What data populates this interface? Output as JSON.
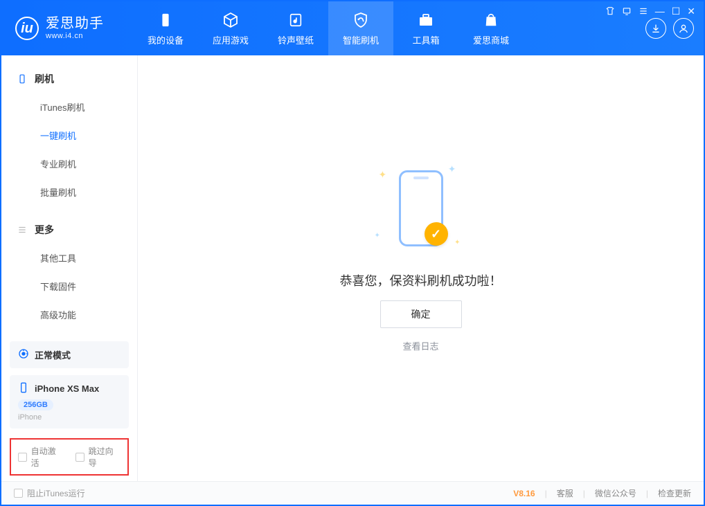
{
  "app": {
    "name": "爱思助手",
    "url": "www.i4.cn"
  },
  "window_ctrls": {
    "shirt": "◇",
    "lock": "☐",
    "menu": "≡",
    "min": "—",
    "max": "☐",
    "close": "✕"
  },
  "tabs": [
    {
      "id": "device",
      "label": "我的设备"
    },
    {
      "id": "apps",
      "label": "应用游戏"
    },
    {
      "id": "media",
      "label": "铃声壁纸"
    },
    {
      "id": "flash",
      "label": "智能刷机",
      "active": true
    },
    {
      "id": "toolbox",
      "label": "工具箱"
    },
    {
      "id": "store",
      "label": "爱思商城"
    }
  ],
  "sidebar": {
    "groups": [
      {
        "title": "刷机",
        "icon": "flash-icon",
        "items": [
          {
            "id": "itunes",
            "label": "iTunes刷机"
          },
          {
            "id": "onekey",
            "label": "一键刷机",
            "active": true
          },
          {
            "id": "pro",
            "label": "专业刷机"
          },
          {
            "id": "batch",
            "label": "批量刷机"
          }
        ]
      },
      {
        "title": "更多",
        "icon": "more-icon",
        "items": [
          {
            "id": "other",
            "label": "其他工具"
          },
          {
            "id": "fw",
            "label": "下载固件"
          },
          {
            "id": "adv",
            "label": "高级功能"
          }
        ]
      }
    ]
  },
  "mode_card": {
    "label": "正常模式"
  },
  "device_card": {
    "name": "iPhone XS Max",
    "capacity": "256GB",
    "type": "iPhone"
  },
  "bottom_opts": {
    "auto_activate": "自动激活",
    "skip_guide": "跳过向导"
  },
  "main": {
    "success_text": "恭喜您，保资料刷机成功啦！",
    "ok_label": "确定",
    "view_log": "查看日志"
  },
  "footer": {
    "block_itunes": "阻止iTunes运行",
    "version": "V8.16",
    "support": "客服",
    "wechat": "微信公众号",
    "check_update": "检查更新"
  }
}
